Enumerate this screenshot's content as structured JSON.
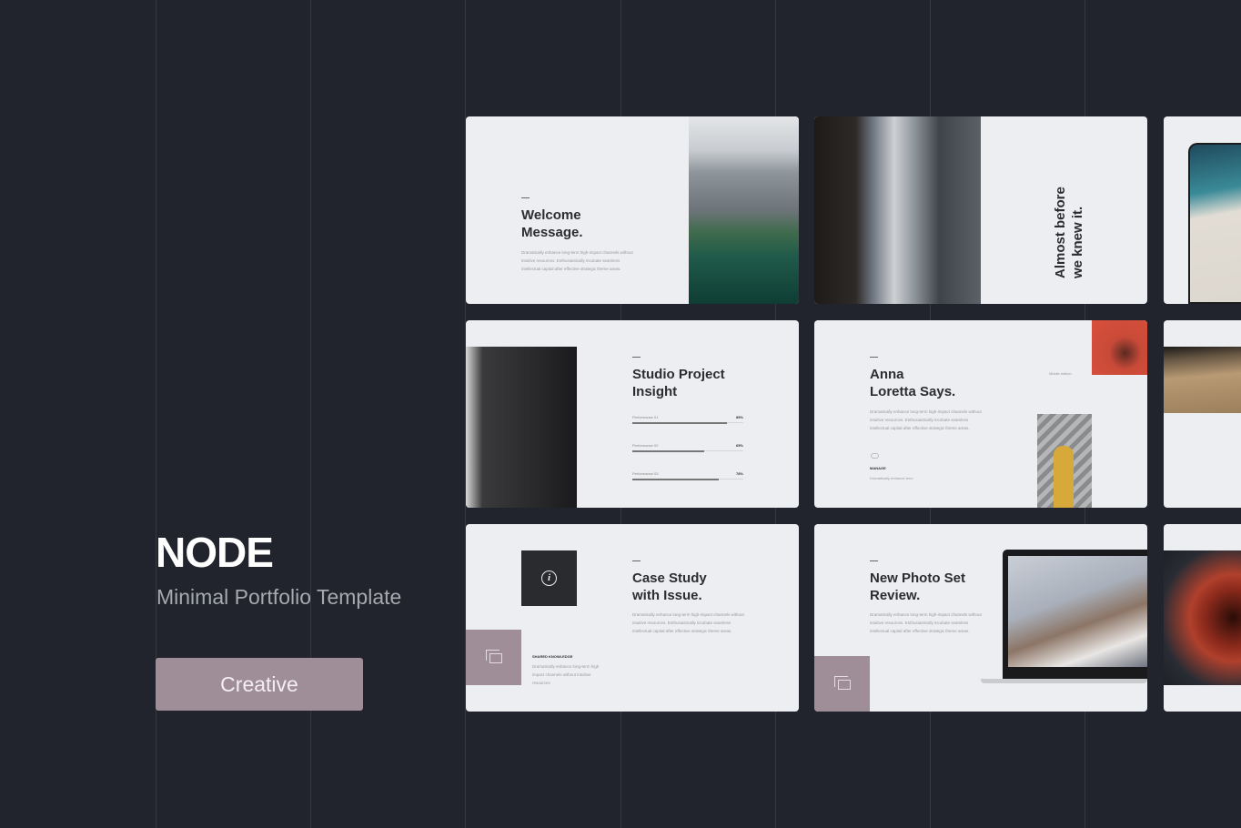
{
  "hero": {
    "title": "NODE",
    "subtitle": "Minimal Portfolio Template",
    "button": "Creative"
  },
  "colors": {
    "background": "#21242c",
    "accent": "#9f8e98",
    "slide": "#eceef1"
  },
  "body_copy": "Dramatically enhance long-term high-impact channels without intuitive resources. Enthusiastically incubate seamless intellectual capital after effective strategic theme areas.",
  "slides": {
    "welcome": {
      "title_1": "Welcome",
      "title_2": "Message."
    },
    "almost": {
      "title_1": "Almost before",
      "title_2": "we knew it."
    },
    "studio": {
      "title_1": "Studio Project",
      "title_2": "Insight",
      "bars": [
        {
          "label": "Performance 01",
          "value": "85%",
          "pct": 85
        },
        {
          "label": "Performance 02",
          "value": "65%",
          "pct": 65
        },
        {
          "label": "Performance 03",
          "value": "78%",
          "pct": 78
        }
      ]
    },
    "anna": {
      "title_1": "Anna",
      "title_2": "Loretta Says.",
      "feature": "MANAGE",
      "feature_text": "Dramatically enhance term",
      "side_label": "Middle edition"
    },
    "case": {
      "title_1": "Case Study",
      "title_2": "with Issue.",
      "icon": "info-icon",
      "feature": "SHARED KNOWLEDGE",
      "feature_text": "Dramatically enhance long-term high impact channels without intuitive resources"
    },
    "photo": {
      "title_1": "New Photo Set",
      "title_2": "Review.",
      "icon": "copy-icon"
    }
  }
}
